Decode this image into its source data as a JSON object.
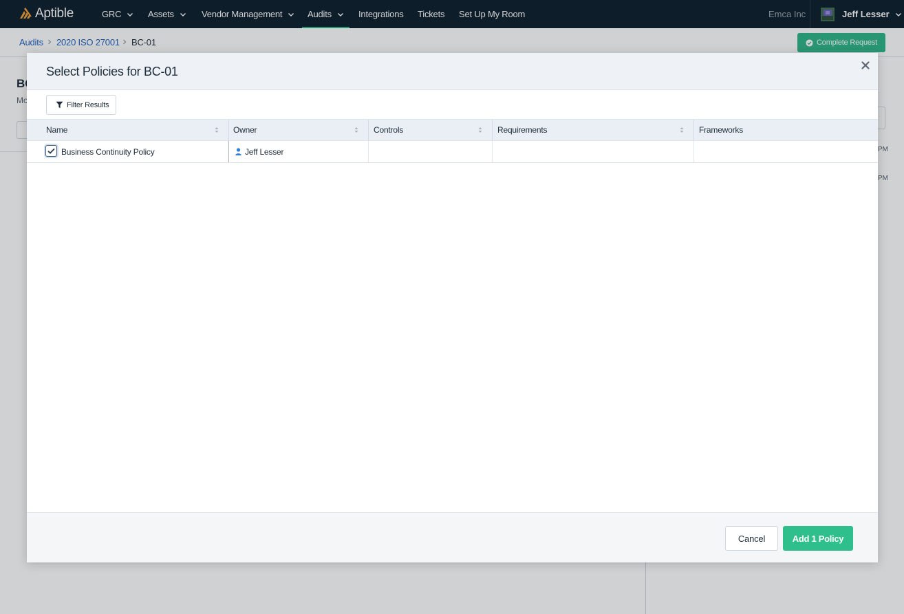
{
  "app": {
    "brand": "Aptible",
    "brand_color": "#f2a33a",
    "accent_color": "#2fb689"
  },
  "nav": {
    "items": [
      {
        "label": "GRC",
        "has_menu": true
      },
      {
        "label": "Assets",
        "has_menu": true
      },
      {
        "label": "Vendor Management",
        "has_menu": true
      },
      {
        "label": "Audits",
        "has_menu": true,
        "active": true
      },
      {
        "label": "Integrations",
        "has_menu": false
      },
      {
        "label": "Tickets",
        "has_menu": false
      },
      {
        "label": "Set Up My Room",
        "has_menu": false
      }
    ],
    "org_name": "Emca Inc",
    "user_name": "Jeff Lesser"
  },
  "breadcrumb": {
    "items": [
      "Audits",
      "2020 ISO 27001",
      "BC-01"
    ]
  },
  "page": {
    "complete_request_label": "Complete Request",
    "title_fragment": "BC",
    "subtitle_fragment": "Mo",
    "side_time_fragment": "PM"
  },
  "modal": {
    "title": "Select Policies for BC-01",
    "filter_label": "Filter Results",
    "columns": [
      "Name",
      "Owner",
      "Controls",
      "Requirements",
      "Frameworks"
    ],
    "rows": [
      {
        "selected": true,
        "name": "Business Continuity Policy",
        "owner": "Jeff Lesser",
        "controls": "",
        "requirements": "",
        "frameworks": ""
      }
    ],
    "cancel_label": "Cancel",
    "add_label": "Add 1 Policy"
  }
}
